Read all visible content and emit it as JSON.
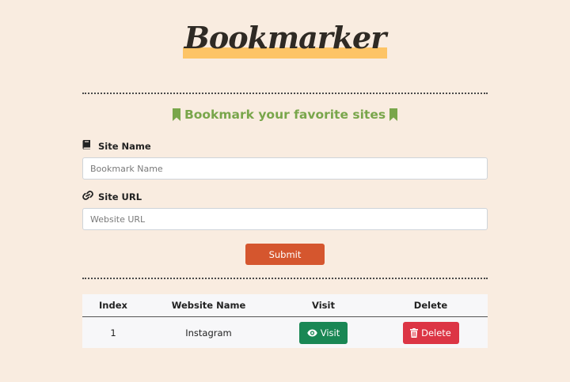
{
  "app": {
    "logo": "Bookmarker",
    "tagline": "Bookmark your favorite sites",
    "tagline_icon": "bookmark-icon",
    "accent_color": "#79a64b",
    "highlight_color": "#fdc466"
  },
  "form": {
    "site_name": {
      "label": "Site Name",
      "icon": "book-icon",
      "placeholder": "Bookmark Name",
      "value": ""
    },
    "site_url": {
      "label": "Site URL",
      "icon": "link-icon",
      "placeholder": "Website URL",
      "value": ""
    },
    "submit_label": "Submit",
    "submit_color": "#d5562e"
  },
  "table": {
    "headers": {
      "index": "Index",
      "website_name": "Website Name",
      "visit": "Visit",
      "delete": "Delete"
    },
    "rows": [
      {
        "index": "1",
        "website_name": "Instagram",
        "visit_label": "Visit",
        "visit_icon": "eye-icon",
        "delete_label": "Delete",
        "delete_icon": "trash-icon"
      }
    ],
    "visit_color": "#198754",
    "delete_color": "#dc3545"
  }
}
